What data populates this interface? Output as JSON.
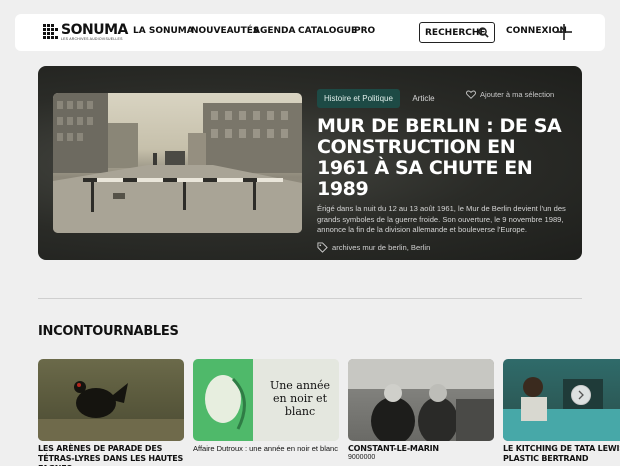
{
  "header": {
    "logo_name": "SONUMA",
    "logo_sub": "LES ARCHIVES AUDIOVISUELLES",
    "nav": [
      "LA SONUMA",
      "NOUVEAUTÉS",
      "AGENDA",
      "CATALOGUE",
      "PRO"
    ],
    "search_label": "RECHERCHE",
    "login_label": "CONNEXION"
  },
  "hero": {
    "category": "Histoire et Politique",
    "type": "Article",
    "add_selection": "Ajouter à ma sélection",
    "title": "MUR DE BERLIN : DE SA CONSTRUCTION EN 1961 À SA CHUTE EN 1989",
    "description": "Érigé dans la nuit du 12 au 13 août 1961, le Mur de Berlin devient l'un des grands symboles de la guerre froide. Son ouverture, le 9 novembre 1989, annonce la fin de la division allemande et bouleverse l'Europe.",
    "tags": "archives mur de berlin, Berlin"
  },
  "section": {
    "title": "INCONTOURNABLES"
  },
  "cards": [
    {
      "title": "LES ARÈNES DE PARADE DES TÉTRAS-LYRES DANS LES HAUTES FAGNES",
      "sub": ""
    },
    {
      "title": "Affaire Dutroux : une année en noir et blanc",
      "sub": "",
      "image_text": "Une année en noir et blanc"
    },
    {
      "title": "CONSTANT-LE-MARIN",
      "sub": "9000000"
    },
    {
      "title": "LE KITCHING DE TATA LEWIS, PLASTIC BERTRAND",
      "sub": ""
    }
  ],
  "colors": {
    "page_bg": "#efefef",
    "hero_bg": "#2a2b27",
    "tag_pill": "#1d4a45",
    "card2_green": "#4fb96a"
  }
}
